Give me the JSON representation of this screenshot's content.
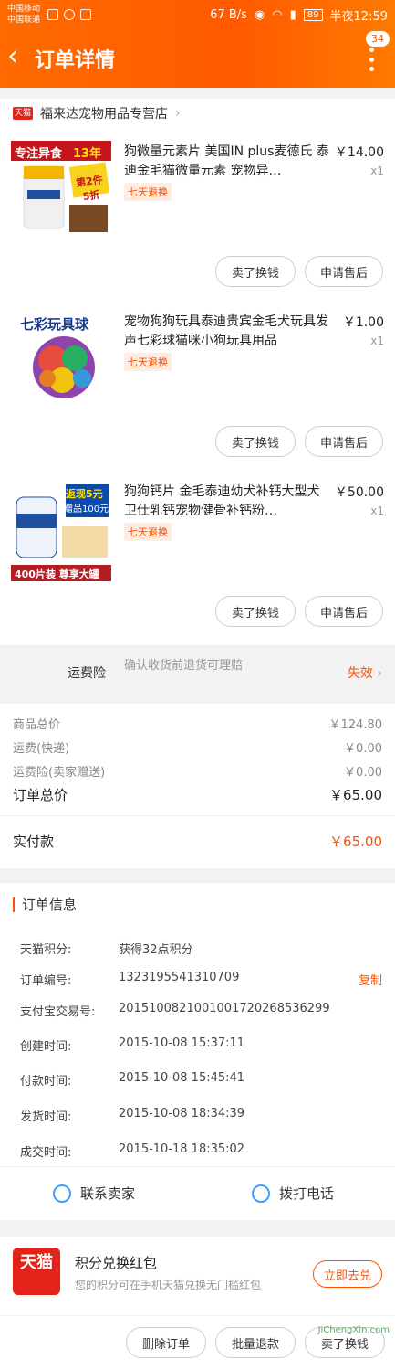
{
  "status_bar": {
    "carrier1": "中国移动",
    "carrier2": "中国联通",
    "speed": "67 B/s",
    "battery": "89",
    "time": "半夜12:59"
  },
  "header": {
    "title": "订单详情",
    "badge": "34"
  },
  "store": {
    "logo_text": "天猫",
    "name": "福来达宠物用品专营店"
  },
  "items": [
    {
      "title": "狗微量元素片 美国IN plus麦德氏 泰迪金毛猫微量元素 宠物异…",
      "price": "￥14.00",
      "qty": "x1",
      "tag": "七天退换",
      "thumb": {
        "label1": "专注异食",
        "label2": "13年",
        "label3": "第2件 5折"
      }
    },
    {
      "title": "宠物狗狗玩具泰迪贵宾金毛犬玩具发声七彩球猫咪小狗玩具用品",
      "price": "￥1.00",
      "qty": "x1",
      "tag": "七天退换",
      "thumb": {
        "label1": "七彩玩具球"
      }
    },
    {
      "title": "狗狗钙片 金毛泰迪幼犬补钙大型犬 卫仕乳钙宠物健骨补钙粉…",
      "price": "￥50.00",
      "qty": "x1",
      "tag": "七天退换",
      "thumb": {
        "label1": "返现5元",
        "label2": "赠品100元",
        "label3": "400片装 尊享大罐"
      }
    }
  ],
  "buttons": {
    "resell": "卖了换钱",
    "after_sale": "申请售后"
  },
  "shipping_insurance": {
    "label": "运费险",
    "desc": "确认收货前退货可理赔",
    "status": "失效"
  },
  "totals": {
    "goods_label": "商品总价",
    "goods_value": "￥124.80",
    "ship_label": "运费(快递)",
    "ship_value": "￥0.00",
    "ins_label": "运费险(卖家赠送)",
    "ins_value": "￥0.00",
    "order_label": "订单总价",
    "order_value": "￥65.00",
    "paid_label": "实付款",
    "paid_value": "￥65.00"
  },
  "order_info": {
    "title": "订单信息",
    "copy": "复制",
    "rows": [
      {
        "k": "天猫积分:",
        "v": "获得32点积分"
      },
      {
        "k": "订单编号:",
        "v": "1323195541310709"
      },
      {
        "k": "支付宝交易号:",
        "v": "2015100821001001720268536299"
      },
      {
        "k": "创建时间:",
        "v": "2015-10-08 15:37:11"
      },
      {
        "k": "付款时间:",
        "v": "2015-10-08 15:45:41"
      },
      {
        "k": "发货时间:",
        "v": "2015-10-08 18:34:39"
      },
      {
        "k": "成交时间:",
        "v": "2015-10-18 18:35:02"
      }
    ]
  },
  "contact": {
    "seller": "联系卖家",
    "call": "拨打电话"
  },
  "promo": {
    "title": "积分兑换红包",
    "subtitle": "您的积分可在手机天猫兑换无门槛红包",
    "action": "立即去兑",
    "logo": "天猫"
  },
  "bottom_bar": {
    "delete": "删除订单",
    "batch_refund": "批量退款",
    "resell": "卖了换钱"
  },
  "watermark": "JiChengXin.com",
  "colors": {
    "accent": "#ff5000",
    "header": "#ff6b00",
    "tmall": "#e2231a"
  }
}
